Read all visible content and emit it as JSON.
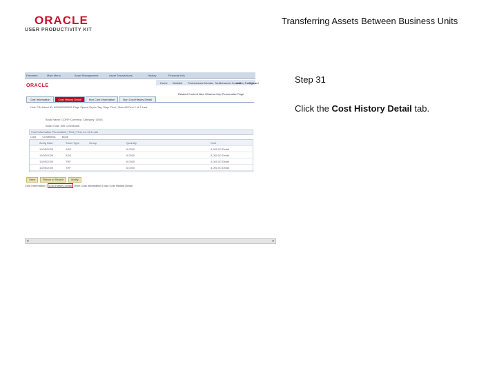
{
  "logo": {
    "brand": "ORACLE",
    "product": "USER PRODUCTIVITY KIT"
  },
  "page_title": "Transferring Assets Between Business Units",
  "step": "Step 31",
  "instruction": {
    "prefix": "Click the ",
    "target": "Cost History Detail",
    "suffix": " tab."
  },
  "screenshot": {
    "nav": [
      "Favorites",
      "Main Menu",
      "Asset Management",
      "Asset Transactions",
      "History",
      "Financial Info"
    ],
    "logo": "ORACLE",
    "topmenu": [
      "Home",
      "Worklist",
      "Performance Monitor",
      "Multichannel Console",
      "Add to Favorites",
      "Sign out"
    ],
    "links": "Related Content  New Window  Help  Personalize Page",
    "tabs": [
      "Cost Information",
      "Cost History Detail",
      "Non Cost Information",
      "Non Cost History Detail"
    ],
    "header_rows": [
      "Unit: FIN   Asset ID: 000000000405   Page Speed Grphx   Tag:   Disp:        Find | View All   First 1 of 1 Last",
      "Book Name: CORP   Currency:   Category: LEAS",
      "Asset Cost: 400   Cost Basis:"
    ],
    "grid_title": "Cost Information   Personalize | Find |    First 1-4 of 4 Last",
    "grid_tabs": [
      "Cost",
      "Chartfields",
      "Book"
    ],
    "grid_columns": [
      "Acctg Date",
      "Trans Type",
      "Group",
      "Quantity",
      "Cost"
    ],
    "grid_rows": [
      [
        "10/05/2005",
        "ADD",
        "",
        "6.0000",
        "4,000.00 Detail"
      ],
      [
        "10/05/2005",
        "ADD",
        "",
        "6.0000",
        "4,000.00 Detail"
      ],
      [
        "10/05/2005",
        "TRF",
        "",
        "6.0000",
        "4,000.00 Detail"
      ],
      [
        "10/05/2005",
        "TRF",
        "",
        "6.0000",
        "4,000.00 Detail"
      ]
    ],
    "buttons": [
      "Save",
      "Return to Search",
      "Notify"
    ],
    "bottom_links": {
      "before": "Cost Information | ",
      "highlight": "Cost History Detail",
      "after": " | Non Cost Information | Non Cost History Detail"
    }
  }
}
